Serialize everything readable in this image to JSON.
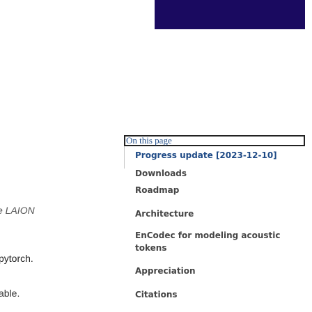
{
  "left_fragments": {
    "line1": "e LAION",
    "line2": "pytorch.",
    "line3": "able."
  },
  "toc": {
    "header": "On this page",
    "items": [
      {
        "label": "Progress update [2023-12-10]",
        "active": true
      },
      {
        "label": "Downloads",
        "active": false
      },
      {
        "label": "Roadmap",
        "active": false
      },
      {
        "label": "Architecture",
        "active": false
      },
      {
        "label": "EnCodec for modeling acoustic tokens",
        "active": false
      },
      {
        "label": "Appreciation",
        "active": false
      },
      {
        "label": "Citations",
        "active": false
      }
    ]
  },
  "colors": {
    "top_bar": "#1a0a60",
    "link_active": "#1e4a86",
    "link_normal": "#454545"
  }
}
